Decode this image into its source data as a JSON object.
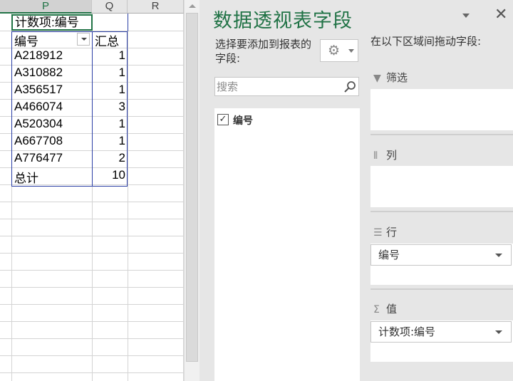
{
  "sheet": {
    "columns": [
      "P",
      "Q",
      "R"
    ],
    "pivot_title": "计数项:编号",
    "header": {
      "row_label": "编号",
      "value_label": "汇总"
    },
    "rows": [
      {
        "id": "A218912",
        "count": "1"
      },
      {
        "id": "A310882",
        "count": "1"
      },
      {
        "id": "A356517",
        "count": "1"
      },
      {
        "id": "A466074",
        "count": "3"
      },
      {
        "id": "A520304",
        "count": "1"
      },
      {
        "id": "A667708",
        "count": "1"
      },
      {
        "id": "A776477",
        "count": "2"
      }
    ],
    "total": {
      "label": "总计",
      "count": "10"
    }
  },
  "pane": {
    "title": "数据透视表字段",
    "close": "✕",
    "choose_fields": "选择要添加到报表的字段:",
    "search_placeholder": "搜索",
    "fields": [
      {
        "name": "编号",
        "checked": true
      }
    ],
    "drag_label": "在以下区域间拖动字段:",
    "areas": {
      "filter": {
        "label": "筛选",
        "icon": "filter-icon"
      },
      "columns": {
        "label": "列",
        "icon": "columns-icon"
      },
      "rows": {
        "label": "行",
        "icon": "rows-icon",
        "field": "编号"
      },
      "values": {
        "label": "值",
        "icon": "sigma-icon",
        "field": "计数项:编号"
      }
    }
  },
  "colors": {
    "accent_green": "#217346",
    "pivot_border": "#2b3fa6",
    "pane_bg": "#e6e6e6"
  }
}
